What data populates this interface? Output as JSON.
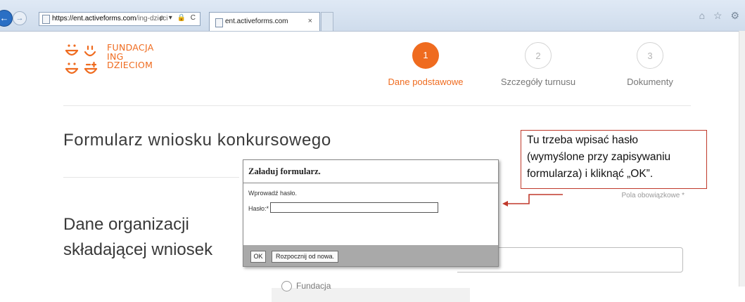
{
  "browser": {
    "address_host": "https://ent.activeforms.com",
    "address_path": "/ing-dzieci",
    "address_controls": "ρ ▾ 🔒 C",
    "tab_title": "ent.activeforms.com",
    "tab_close": "×",
    "back_glyph": "←",
    "forward_glyph": "→",
    "right_icons": "⌂ ☆ ⚙"
  },
  "logo": {
    "lines": [
      "FUNDACJA",
      "ING",
      "DZIECIOM"
    ],
    "brand_color": "#ef6b1f"
  },
  "steps": [
    {
      "number": "1",
      "label": "Dane podstawowe",
      "active": true
    },
    {
      "number": "2",
      "label": "Szczegóły turnusu",
      "active": false
    },
    {
      "number": "3",
      "label": "Dokumenty",
      "active": false
    }
  ],
  "page": {
    "form_title": "Formularz wniosku konkursowego",
    "required_note": "Pola obowiązkowe *",
    "section_title": "Dane organizacji składającej wniosek",
    "radio_option": "Fundacja"
  },
  "annotation": {
    "lines": [
      "Tu trzeba wpisać hasło",
      "(wymyślone przy zapisywaniu",
      "formularza) i kliknąć „OK”."
    ],
    "border_color": "#c0392b"
  },
  "dialog": {
    "title": "Załaduj formularz.",
    "prompt": "Wprowadź hasło.",
    "password_label": "Hasło:*",
    "password_value": "",
    "ok_label": "OK",
    "reset_label": "Rozpocznij od nowa."
  }
}
